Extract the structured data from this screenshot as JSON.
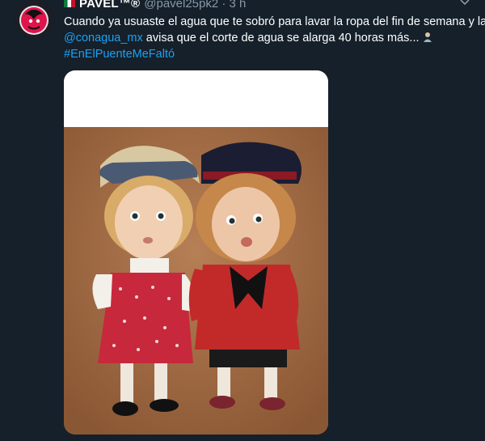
{
  "tweet": {
    "display_name": "PAVEL™®",
    "handle": "@pavel25pk2 · 3 h",
    "text_line1": "Cuando ya usuaste el agua que te sobró para lavar la ropa del fin de semana y la",
    "mention": "@conagua_mx",
    "text_line2_rest": " avisa que el corte de agua se alarga 40 horas más...",
    "hashtag": "#EnElPuenteMeFaltó"
  },
  "colors": {
    "background": "#15202b",
    "link": "#1da1f2",
    "muted": "#8899a6"
  },
  "icons": {
    "more": "chevron-down-icon",
    "flag": "mexico-flag-icon",
    "emoji": "person-gesturing-emoji-icon"
  }
}
